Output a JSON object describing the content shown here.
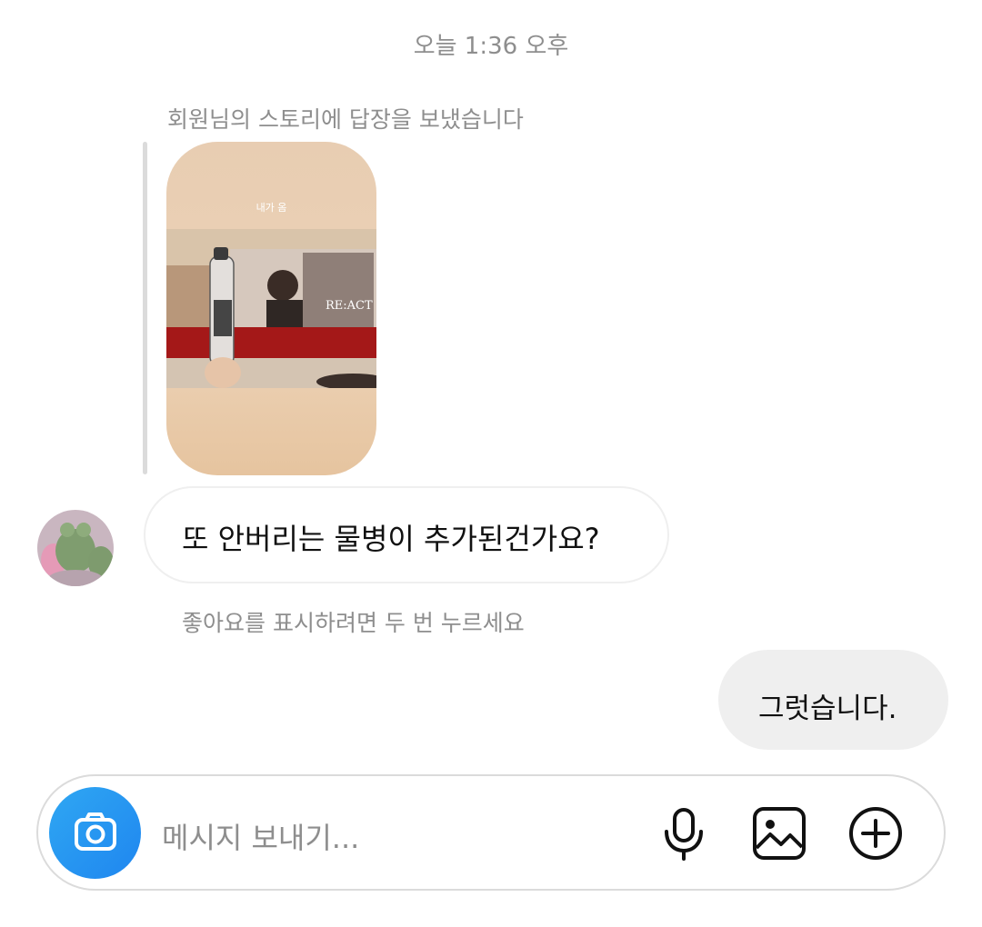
{
  "timestamp": "오늘 1:36 오후",
  "story_reply": {
    "caption": "회원님의 스토리에 답장을 보냈습니다",
    "story_text": "내가 옴",
    "banner_text": "RE:ACT"
  },
  "messages": [
    {
      "direction": "incoming",
      "text": "또 안버리는 물병이 추가된건가요?"
    },
    {
      "direction": "outgoing",
      "text": "그럿습니다."
    }
  ],
  "like_hint": "좋아요를 표시하려면 두 번 누르세요",
  "composer": {
    "placeholder": "메시지 보내기...",
    "icons": [
      "camera-icon",
      "microphone-icon",
      "gallery-icon",
      "add-icon"
    ]
  },
  "colors": {
    "accent": "#1f86f0",
    "muted_text": "#8e8e8e",
    "bubble_outgoing": "#efefef",
    "story_background": "#e8cdb2"
  }
}
